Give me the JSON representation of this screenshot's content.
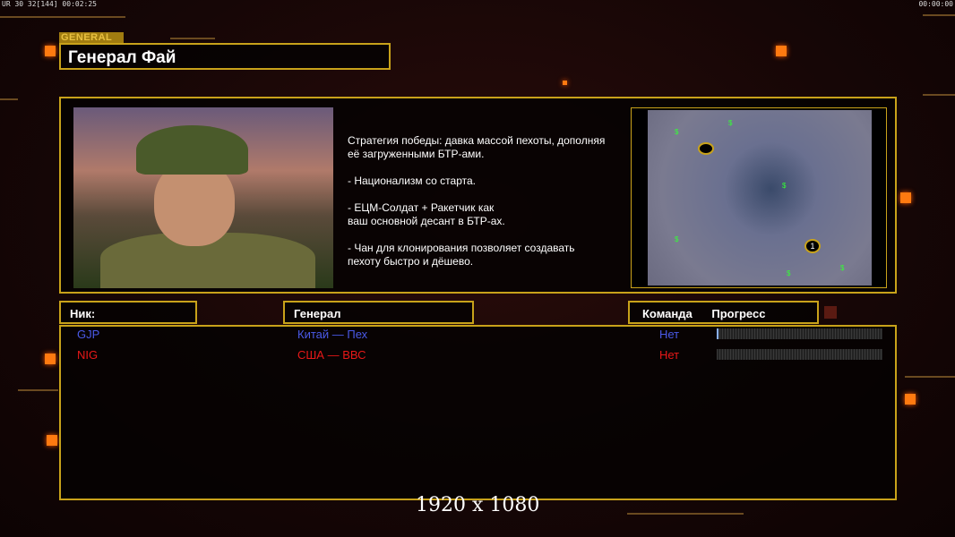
{
  "hud": {
    "left": "UR 30 32[144] 00:02:25",
    "right": "00:00:00"
  },
  "header": {
    "tag": "GENERAL",
    "title": "Генерал Фай"
  },
  "description": "Стратегия победы: давка массой пехоты, дополняя\n её загруженными БТР-ами.\n\n- Национализм со старта.\n\n- ЕЦМ-Солдат + Ракетчик как\nваш основной десант в БТР-ах.\n\n- Чан для клонирования позволяет создавать\n пехоту быстро и дёшево.",
  "map": {
    "start_markers": [
      "1"
    ],
    "supply": "$"
  },
  "columns": {
    "nick": "Ник:",
    "general": "Генерал",
    "team": "Команда",
    "progress": "Прогресс"
  },
  "players": [
    {
      "nick": "GJP",
      "general": "Китай — Пех",
      "team": "Нет",
      "progress": 0.01,
      "color": "#4a5ae8"
    },
    {
      "nick": "NIG",
      "general": "США — ВВС",
      "team": "Нет",
      "progress": 0,
      "color": "#e81818"
    }
  ],
  "resolution": "1920 x 1080"
}
